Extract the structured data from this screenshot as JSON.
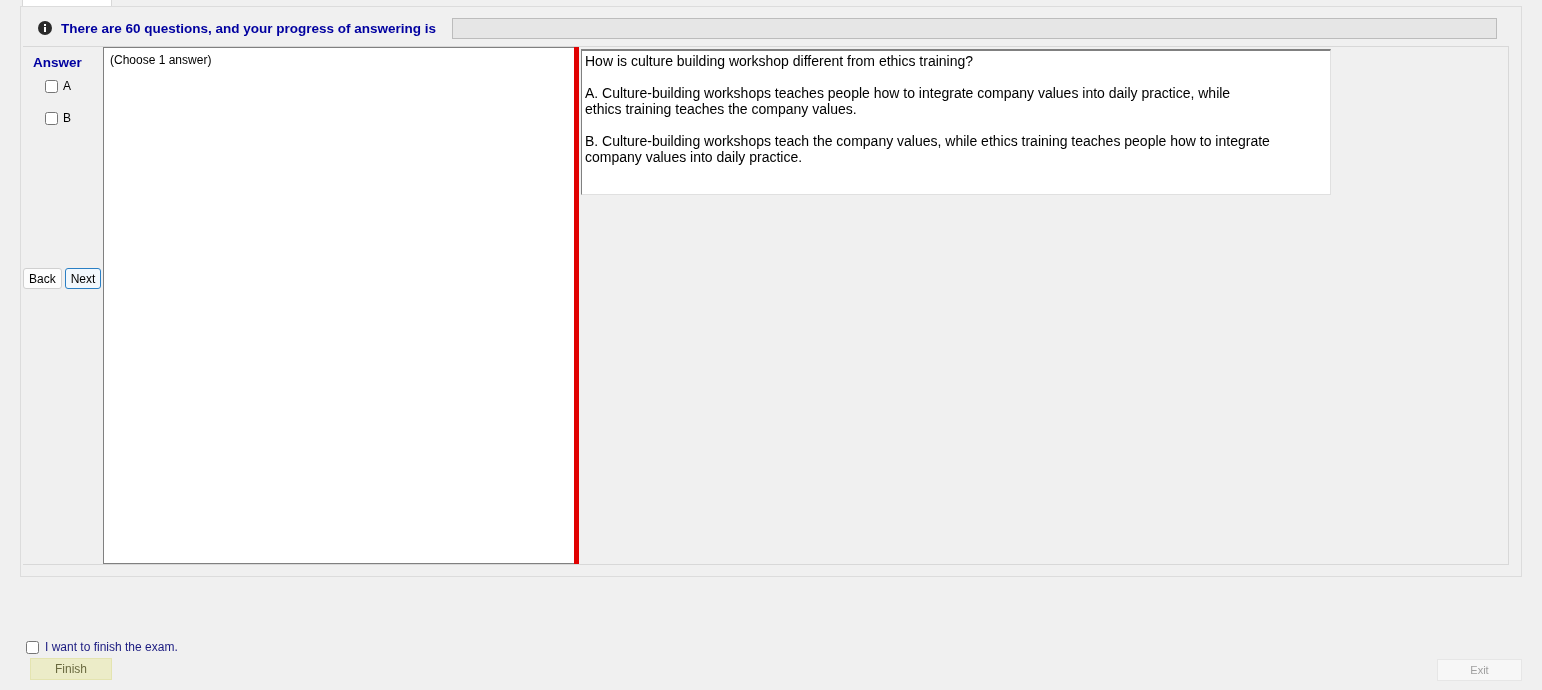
{
  "header": {
    "text": "There are 60 questions, and your progress of answering is",
    "progress": {
      "level": 0
    }
  },
  "answer": {
    "title": "Answer",
    "options": [
      {
        "label": "A",
        "checked": false
      },
      {
        "label": "B",
        "checked": false
      }
    ],
    "buttons": [
      {
        "label": "Back",
        "focused": false
      },
      {
        "label": "Next",
        "focused": true
      }
    ]
  },
  "choices_pane": {
    "instruction": "(Choose 1 answer)"
  },
  "question": {
    "paragraphs": [
      "How is culture building workshop different from ethics training?",
      "A.  Culture-building workshops teaches people how to integrate company values into daily practice, while ethics training teaches the company values.",
      "B.  Culture-building workshops teach the company values, while ethics training teaches people how to integrate company values into daily practice."
    ]
  },
  "footer": {
    "finish_check": {
      "label": "I want to finish the exam.",
      "checked": false
    },
    "finish_button": {
      "label": "Finish",
      "disabled": true
    },
    "exit_button": {
      "label": "Exit",
      "disabled": true
    }
  }
}
